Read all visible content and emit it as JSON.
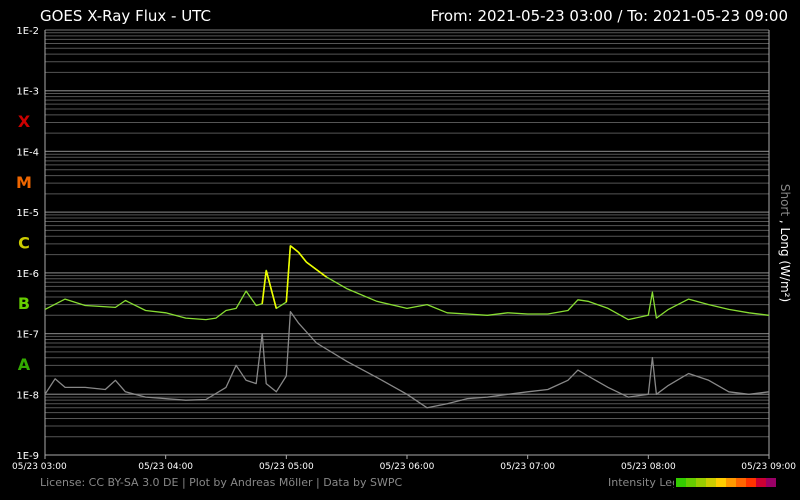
{
  "header": {
    "title": "GOES X-Ray Flux - UTC",
    "range": "From: 2021-05-23 03:00  /  To: 2021-05-23 09:00"
  },
  "side_label": {
    "short": "Short",
    "sep": " , ",
    "long": "Long (W/m²)"
  },
  "footer": {
    "license": "License: CC BY-SA 3.0 DE | Plot by Andreas Möller | Data by SWPC",
    "legend_label": "Intensity Legend",
    "legend_colors": [
      "#33cc00",
      "#66cc00",
      "#99cc00",
      "#cccc00",
      "#ffcc00",
      "#ff9900",
      "#ff6600",
      "#ff3300",
      "#cc0033",
      "#990066"
    ]
  },
  "chart_data": {
    "type": "line",
    "title": "GOES X-Ray Flux - UTC",
    "ylabel": "Short , Long (W/m²)",
    "yscale": "log",
    "ylim": [
      1e-09,
      0.01
    ],
    "yticks": [
      "1E-2",
      "1E-3",
      "1E-4",
      "1E-5",
      "1E-6",
      "1E-7",
      "1E-8",
      "1E-9"
    ],
    "xlim": [
      "05/23 03:00",
      "05/23 09:00"
    ],
    "xticks": [
      "05/23 03:00",
      "05/23 04:00",
      "05/23 05:00",
      "05/23 06:00",
      "05/23 07:00",
      "05/23 08:00",
      "05/23 09:00"
    ],
    "flare_classes": [
      {
        "label": "X",
        "color": "#cc0000",
        "level": 0.000316
      },
      {
        "label": "M",
        "color": "#ee6600",
        "level": 3.16e-05
      },
      {
        "label": "C",
        "color": "#cccc00",
        "level": 3.16e-06
      },
      {
        "label": "B",
        "color": "#66cc00",
        "level": 3.16e-07
      },
      {
        "label": "A",
        "color": "#33aa00",
        "level": 3.16e-08
      }
    ],
    "grid": true,
    "series": [
      {
        "name": "Long",
        "color": "#88dd33",
        "peak_color": "#eeff00",
        "x": [
          "03:00",
          "03:10",
          "03:20",
          "03:35",
          "03:40",
          "03:50",
          "04:00",
          "04:10",
          "04:20",
          "04:25",
          "04:30",
          "04:35",
          "04:40",
          "04:45",
          "04:48",
          "04:50",
          "04:55",
          "05:00",
          "05:02",
          "05:06",
          "05:10",
          "05:20",
          "05:30",
          "05:45",
          "06:00",
          "06:10",
          "06:20",
          "06:30",
          "06:40",
          "06:50",
          "07:00",
          "07:10",
          "07:20",
          "07:25",
          "07:30",
          "07:40",
          "07:50",
          "08:00",
          "08:02",
          "08:04",
          "08:10",
          "08:20",
          "08:30",
          "08:40",
          "08:50",
          "09:00"
        ],
        "y": [
          2.5e-07,
          3.7e-07,
          2.9e-07,
          2.7e-07,
          3.5e-07,
          2.4e-07,
          2.2e-07,
          1.8e-07,
          1.7e-07,
          1.8e-07,
          2.4e-07,
          2.6e-07,
          5e-07,
          2.9e-07,
          3.1e-07,
          1.1e-06,
          2.6e-07,
          3.3e-07,
          2.8e-06,
          2.2e-06,
          1.5e-06,
          8.5e-07,
          5.5e-07,
          3.4e-07,
          2.6e-07,
          3e-07,
          2.2e-07,
          2.1e-07,
          2e-07,
          2.2e-07,
          2.1e-07,
          2.1e-07,
          2.4e-07,
          3.6e-07,
          3.4e-07,
          2.6e-07,
          1.7e-07,
          2e-07,
          4.8e-07,
          1.8e-07,
          2.5e-07,
          3.7e-07,
          3e-07,
          2.5e-07,
          2.2e-07,
          2e-07
        ]
      },
      {
        "name": "Short",
        "color": "#888888",
        "x": [
          "03:00",
          "03:05",
          "03:10",
          "03:20",
          "03:30",
          "03:35",
          "03:40",
          "03:50",
          "04:00",
          "04:10",
          "04:20",
          "04:30",
          "04:35",
          "04:40",
          "04:45",
          "04:48",
          "04:50",
          "04:55",
          "05:00",
          "05:02",
          "05:06",
          "05:15",
          "05:30",
          "05:45",
          "06:00",
          "06:10",
          "06:20",
          "06:30",
          "06:40",
          "06:50",
          "07:00",
          "07:10",
          "07:20",
          "07:25",
          "07:30",
          "07:40",
          "07:50",
          "08:00",
          "08:02",
          "08:04",
          "08:10",
          "08:20",
          "08:30",
          "08:40",
          "08:50",
          "09:00"
        ],
        "y": [
          1e-08,
          1.8e-08,
          1.3e-08,
          1.3e-08,
          1.2e-08,
          1.7e-08,
          1.1e-08,
          9e-09,
          8.5e-09,
          8e-09,
          8.2e-09,
          1.3e-08,
          3e-08,
          1.7e-08,
          1.5e-08,
          1e-07,
          1.5e-08,
          1.1e-08,
          2e-08,
          2.3e-07,
          1.5e-07,
          7e-08,
          3.5e-08,
          1.9e-08,
          1e-08,
          6e-09,
          7e-09,
          8.5e-09,
          9e-09,
          1e-08,
          1.1e-08,
          1.2e-08,
          1.7e-08,
          2.5e-08,
          2e-08,
          1.3e-08,
          9e-09,
          1e-08,
          4e-08,
          1e-08,
          1.4e-08,
          2.2e-08,
          1.7e-08,
          1.1e-08,
          1e-08,
          1.1e-08
        ]
      }
    ]
  }
}
